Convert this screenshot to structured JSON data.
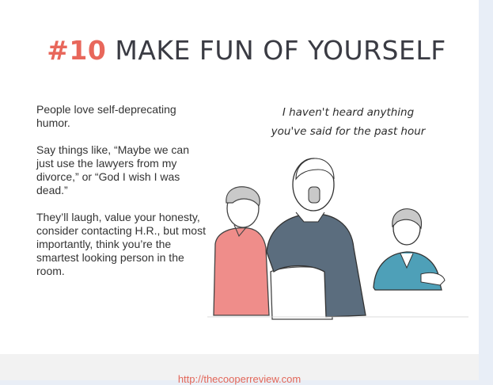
{
  "title": {
    "number": "#10",
    "text": "MAKE FUN OF YOURSELF"
  },
  "body": {
    "p1": "People love self-deprecating humor.",
    "p2": "Say things like, “Maybe we can just use the lawyers from my divorce,” or “God I wish I was dead.”",
    "p3": "They’ll laugh, value your honesty, consider contacting H.R., but most importantly, think you’re the smartest looking person in the room."
  },
  "speech": "I haven't heard anything you've said for the past hour",
  "footer": {
    "link": "http://thecooperreview.com"
  },
  "colors": {
    "accent": "#e8675b",
    "title": "#3a3b43",
    "pink_shirt": "#ef8d8a",
    "teal_shirt": "#4ea0b8",
    "jacket": "#5b6d7e"
  }
}
